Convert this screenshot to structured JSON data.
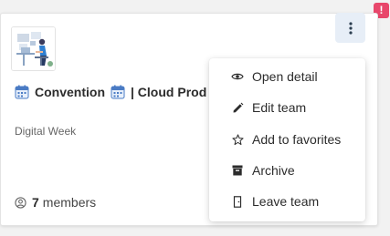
{
  "alert_badge": {
    "label": "!",
    "color": "#e8476b"
  },
  "team_card": {
    "title_parts": [
      "Convention",
      "| Cloud Prod"
    ],
    "title_icon": "calendar-icon",
    "subtitle": "Digital Week",
    "members": {
      "icon": "user-circle-icon",
      "count": "7",
      "label": "members"
    },
    "thumbnail": "illustration-person-at-desk"
  },
  "kebab_menu": {
    "button_icon": "kebab-vertical-icon",
    "button_bg": "#e7eef7",
    "items": [
      {
        "icon": "eye-icon",
        "label": "Open detail"
      },
      {
        "icon": "pencil-icon",
        "label": "Edit team"
      },
      {
        "icon": "star-outline-icon",
        "label": "Add to favorites"
      },
      {
        "icon": "archive-icon",
        "label": "Archive"
      },
      {
        "icon": "door-exit-icon",
        "label": "Leave team"
      }
    ]
  }
}
